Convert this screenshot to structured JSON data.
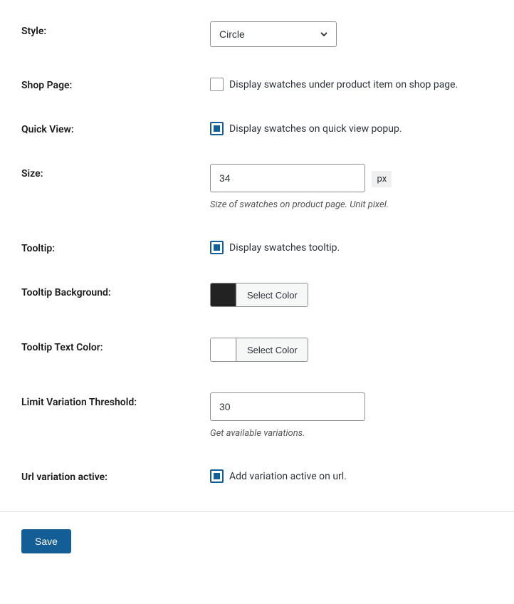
{
  "style": {
    "label": "Style:",
    "selected": "Circle"
  },
  "shop_page": {
    "label": "Shop Page:",
    "checkbox_label": "Display swatches under product item on shop page.",
    "checked": false
  },
  "quick_view": {
    "label": "Quick View:",
    "checkbox_label": "Display swatches on quick view popup.",
    "checked": true
  },
  "size": {
    "label": "Size:",
    "value": "34",
    "unit": "px",
    "help": "Size of swatches on product page. Unit pixel."
  },
  "tooltip": {
    "label": "Tooltip:",
    "checkbox_label": "Display swatches tooltip.",
    "checked": true
  },
  "tooltip_bg": {
    "label": "Tooltip Background:",
    "swatch_color": "#222222",
    "button": "Select Color"
  },
  "tooltip_text": {
    "label": "Tooltip Text Color:",
    "swatch_color": "#ffffff",
    "button": "Select Color"
  },
  "limit_threshold": {
    "label": "Limit Variation Threshold:",
    "value": "30",
    "help": "Get available variations."
  },
  "url_variation": {
    "label": "Url variation active:",
    "checkbox_label": "Add variation active on url.",
    "checked": true
  },
  "save_button": "Save"
}
